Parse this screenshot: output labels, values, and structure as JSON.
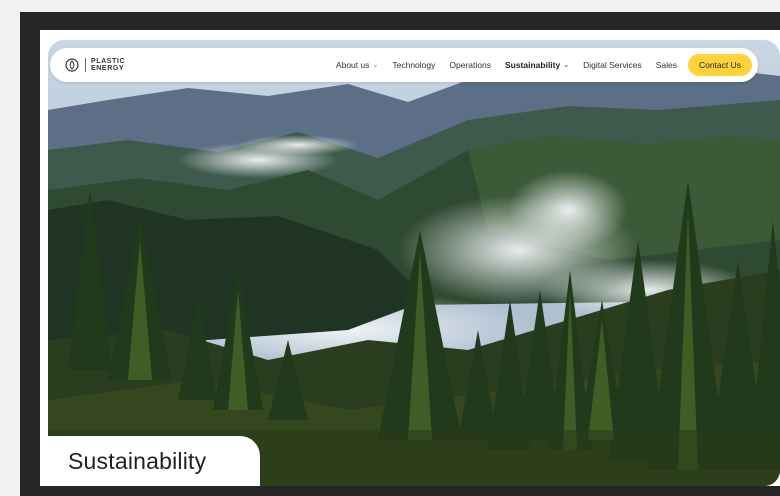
{
  "logo": {
    "line1": "PLASTIC",
    "line2": "ENERGY",
    "icon": "leaf-drop-icon"
  },
  "nav": {
    "items": [
      {
        "label": "About us",
        "has_dropdown": true,
        "active": false
      },
      {
        "label": "Technology",
        "has_dropdown": false,
        "active": false
      },
      {
        "label": "Operations",
        "has_dropdown": false,
        "active": false
      },
      {
        "label": "Sustainability",
        "has_dropdown": true,
        "active": true
      },
      {
        "label": "Digital Services",
        "has_dropdown": false,
        "active": false
      },
      {
        "label": "Sales",
        "has_dropdown": false,
        "active": false
      }
    ],
    "cta": "Contact Us"
  },
  "hero": {
    "title": "Sustainability",
    "image": "misty-forest-landscape"
  },
  "colors": {
    "cta": "#ffd43b",
    "frame": "#262626",
    "page": "#ffffff"
  }
}
